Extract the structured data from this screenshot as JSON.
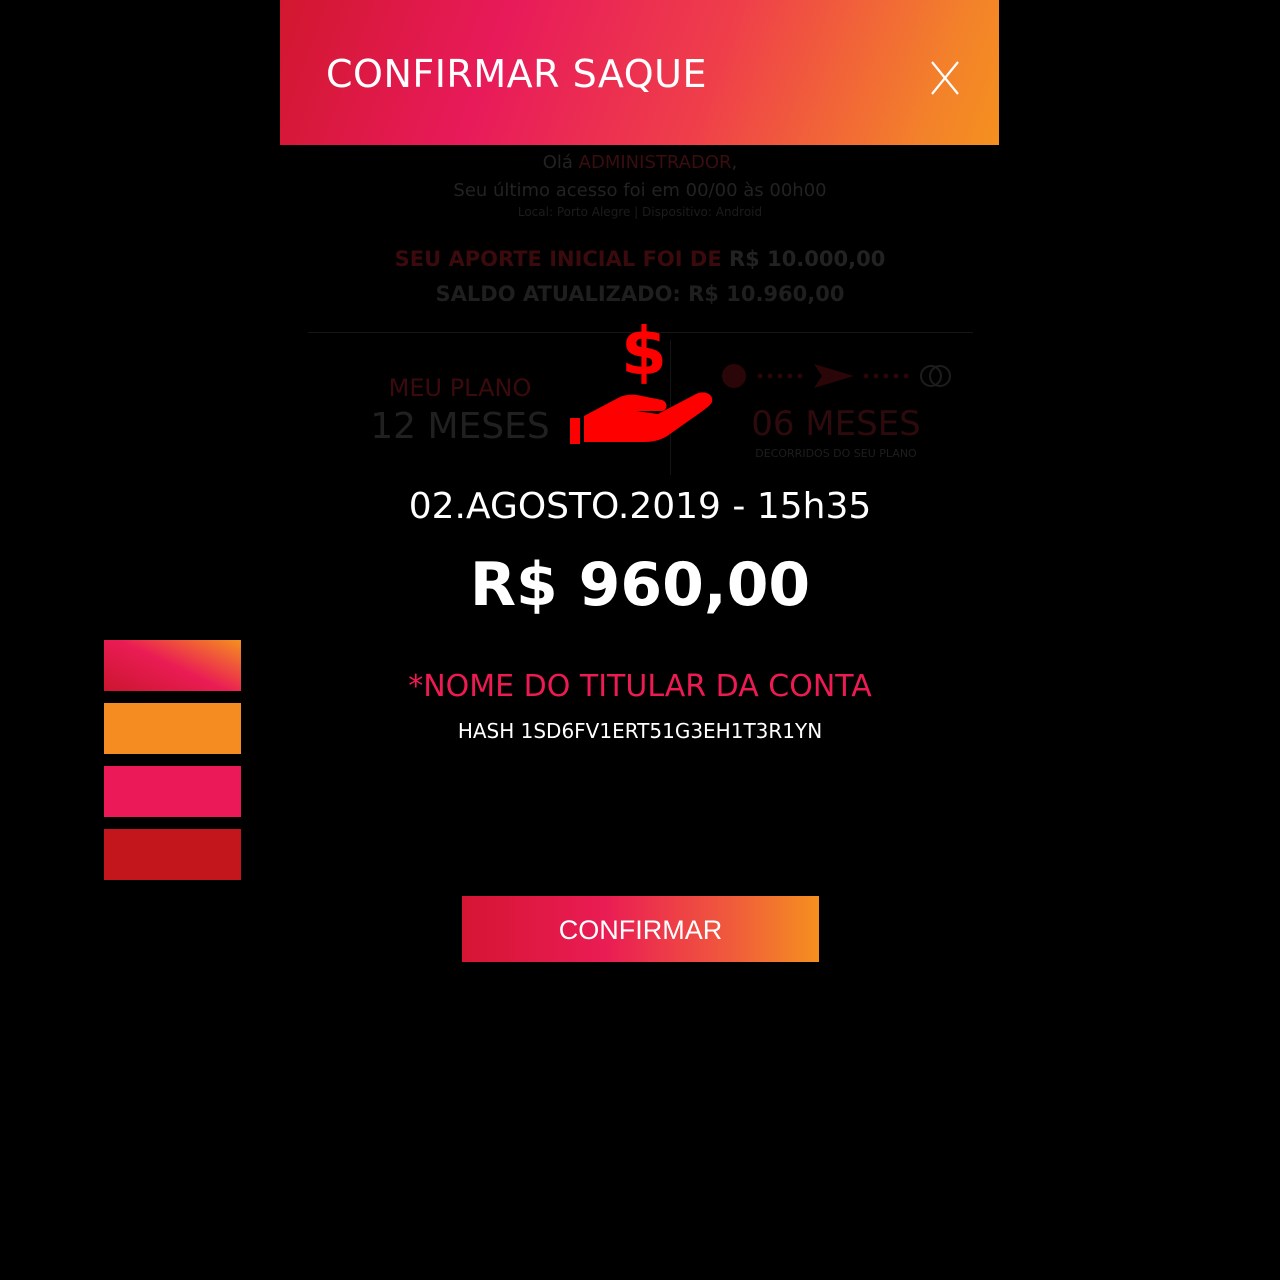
{
  "modal": {
    "title": "CONFIRMAR SAQUE",
    "close_label": "X",
    "datetime": "02.AGOSTO.2019 - 15h35",
    "amount": "R$ 960,00",
    "holder_name": "*NOME DO TITULAR DA CONTA",
    "hash": "HASH 1SD6FV1ERT51G3EH1T3R1YN",
    "confirm_label": "CONFIRMAR"
  },
  "background": {
    "greeting_prefix": "Olá",
    "greeting_user": "ADMINISTRADOR",
    "greeting_suffix": ",",
    "last_access": "Seu último acesso foi em 00/00 às 00h00",
    "device_info": "Local: Porto Alegre | Dispositivo: Android",
    "aporte_label": "SEU APORTE INICIAL FOI DE",
    "aporte_value": "R$ 10.000,00",
    "saldo": "SALDO ATUALIZADO: R$ 10.960,00",
    "plan_label": "MEU PLANO",
    "plan_value": "12 MESES",
    "elapsed_value": "06 MESES",
    "elapsed_label": "DECORRIDOS DO SEU PLANO"
  },
  "colors": {
    "accent_pink": "#ec1958",
    "accent_orange": "#f58c22",
    "accent_red": "#c3161c",
    "icon_red": "#ff0000"
  },
  "swatches": [
    "gradient",
    "#f58c22",
    "#ec1958",
    "#c3161c"
  ],
  "icons": {
    "money": "hand-holding-dollar-icon",
    "close": "close-icon"
  }
}
